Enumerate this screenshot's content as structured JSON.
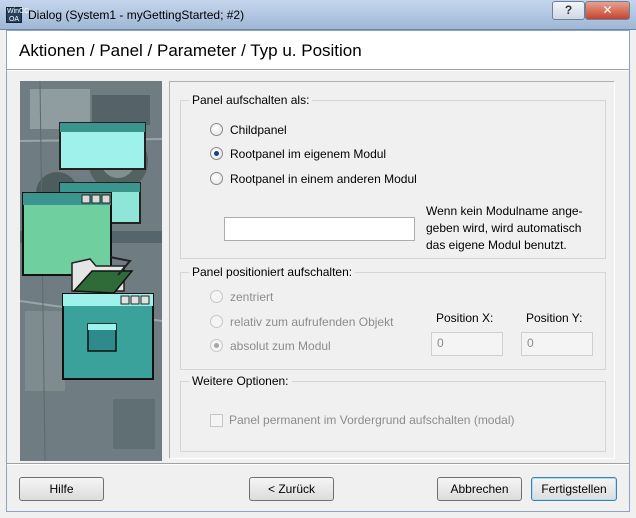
{
  "window": {
    "title": "Dialog (System1 - myGettingStarted; #2)",
    "app_icon_text": "WinCC OA",
    "help_button": "?",
    "close_button": "✕"
  },
  "header": {
    "title": "Aktionen / Panel / Parameter / Typ u. Position"
  },
  "group_open": {
    "legend": "Panel aufschalten als:",
    "options": [
      {
        "label": "Childpanel",
        "checked": false
      },
      {
        "label": "Rootpanel im eigenem Modul",
        "checked": true
      },
      {
        "label": "Rootpanel in einem anderen Modul",
        "checked": false
      }
    ],
    "module_input_value": "",
    "note_lines": [
      "Wenn kein Modulname ange-",
      "geben wird, wird automatisch",
      "das eigene Modul benutzt."
    ]
  },
  "group_position": {
    "legend": "Panel positioniert aufschalten:",
    "options": [
      {
        "label": "zentriert",
        "checked": false,
        "enabled": false
      },
      {
        "label": "relativ zum aufrufenden Objekt",
        "checked": false,
        "enabled": false
      },
      {
        "label": "absolut zum Modul",
        "checked": true,
        "enabled": false
      }
    ],
    "position_x_label": "Position X:",
    "position_y_label": "Position Y:",
    "position_x_value": "0",
    "position_y_value": "0"
  },
  "group_more": {
    "legend": "Weitere Optionen:",
    "modal_checkbox_label": "Panel permanent im Vordergrund aufschalten (modal)",
    "modal_checked": false
  },
  "buttons": {
    "help": "Hilfe",
    "back": "< Zurück",
    "cancel": "Abbrechen",
    "finish": "Fertigstellen"
  },
  "colors": {
    "panel_teal": "#6fcf9f",
    "panel_cyan": "#9ff2ec",
    "dark_teal": "#3a958e"
  }
}
